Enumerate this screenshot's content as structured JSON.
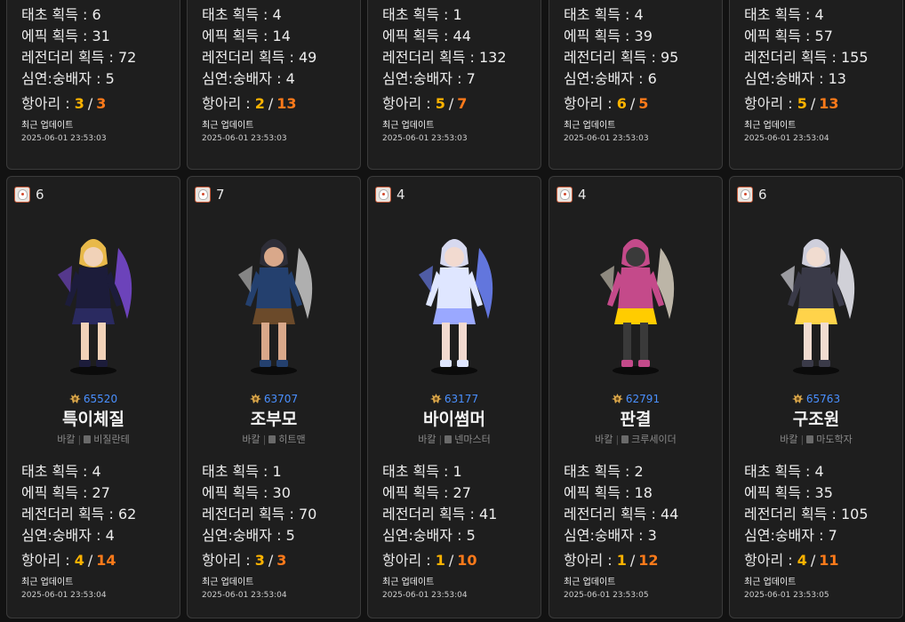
{
  "colors": {
    "current": "#ffb300",
    "max": "#ff7a1a",
    "fame": "#4a90ff",
    "card_bg": "#1e1e1e"
  },
  "labels": {
    "taecho": "태초 획득 : ",
    "epic": "에픽 획득 : ",
    "legendary": "레전더리 획득 : ",
    "abyss": "심연:숭배자 : ",
    "hang": "항아리 : ",
    "slash": "/",
    "updated": "최근 업데이트"
  },
  "top_row": [
    {
      "taecho": "6",
      "epic": "31",
      "legendary": "72",
      "abyss": "5",
      "hang_cur": "3",
      "hang_max": "3",
      "updated": "2025-06-01 23:53:03"
    },
    {
      "taecho": "4",
      "epic": "14",
      "legendary": "49",
      "abyss": "4",
      "hang_cur": "2",
      "hang_max": "13",
      "updated": "2025-06-01 23:53:03"
    },
    {
      "taecho": "1",
      "epic": "44",
      "legendary": "132",
      "abyss": "7",
      "hang_cur": "5",
      "hang_max": "7",
      "updated": "2025-06-01 23:53:03"
    },
    {
      "taecho": "4",
      "epic": "39",
      "legendary": "95",
      "abyss": "6",
      "hang_cur": "6",
      "hang_max": "5",
      "updated": "2025-06-01 23:53:03"
    },
    {
      "taecho": "4",
      "epic": "57",
      "legendary": "155",
      "abyss": "13",
      "hang_cur": "5",
      "hang_max": "13",
      "updated": "2025-06-01 23:53:04"
    }
  ],
  "bottom_row": [
    {
      "rank": "6",
      "icon": "server-icon",
      "fame": "65520",
      "name": "특이체질",
      "server": "바칼",
      "job": "비질란테",
      "taecho": "4",
      "epic": "27",
      "legendary": "62",
      "abyss": "4",
      "hang_cur": "4",
      "hang_max": "14",
      "updated": "2025-06-01 23:53:04"
    },
    {
      "rank": "7",
      "icon": "server-icon",
      "fame": "63707",
      "name": "조부모",
      "server": "바칼",
      "job": "히트맨",
      "taecho": "1",
      "epic": "30",
      "legendary": "70",
      "abyss": "5",
      "hang_cur": "3",
      "hang_max": "3",
      "updated": "2025-06-01 23:53:04"
    },
    {
      "rank": "4",
      "icon": "server-icon",
      "fame": "63177",
      "name": "바이썸머",
      "server": "바칼",
      "job": "넨마스터",
      "taecho": "1",
      "epic": "27",
      "legendary": "41",
      "abyss": "5",
      "hang_cur": "1",
      "hang_max": "10",
      "updated": "2025-06-01 23:53:04"
    },
    {
      "rank": "4",
      "icon": "server-icon",
      "fame": "62791",
      "name": "판결",
      "server": "바칼",
      "job": "크루세이더",
      "taecho": "2",
      "epic": "18",
      "legendary": "44",
      "abyss": "3",
      "hang_cur": "1",
      "hang_max": "12",
      "updated": "2025-06-01 23:53:05"
    },
    {
      "rank": "6",
      "icon": "server-icon",
      "fame": "65763",
      "name": "구조원",
      "server": "바칼",
      "job": "마도학자",
      "taecho": "4",
      "epic": "35",
      "legendary": "105",
      "abyss": "7",
      "hang_cur": "4",
      "hang_max": "11",
      "updated": "2025-06-01 23:53:05"
    }
  ]
}
